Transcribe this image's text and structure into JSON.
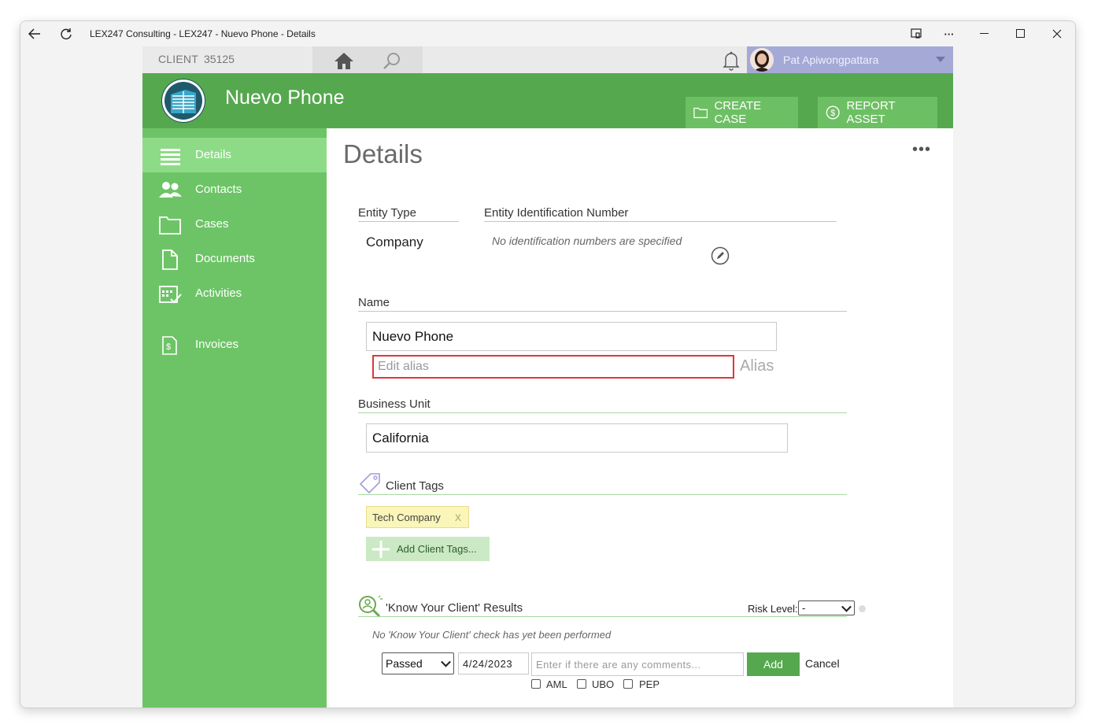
{
  "window": {
    "title": "LEX247 Consulting - LEX247 - Nuevo Phone - Details"
  },
  "topbar": {
    "client_label": "CLIENT",
    "client_id": "35125",
    "user_name": "Pat Apiwongpattara"
  },
  "banner": {
    "company_name": "Nuevo Phone",
    "create_case": "CREATE CASE",
    "report_asset": "REPORT ASSET"
  },
  "sidebar": {
    "items": [
      {
        "label": "Details",
        "icon": "list-icon",
        "active": true
      },
      {
        "label": "Contacts",
        "icon": "contacts-icon"
      },
      {
        "label": "Cases",
        "icon": "folder-icon"
      },
      {
        "label": "Documents",
        "icon": "document-icon"
      },
      {
        "label": "Activities",
        "icon": "calendar-check-icon"
      },
      {
        "label": "Invoices",
        "icon": "invoice-icon"
      }
    ]
  },
  "page": {
    "title": "Details",
    "more": "•••",
    "entity_type_label": "Entity Type",
    "entity_type_value": "Company",
    "entity_id_label": "Entity Identification Number",
    "entity_id_note": "No identification numbers are specified",
    "name_label": "Name",
    "name_value": "Nuevo Phone",
    "alias_placeholder": "Edit alias",
    "alias_label": "Alias",
    "business_unit_label": "Business Unit",
    "business_unit_value": "California",
    "client_tags_label": "Client Tags",
    "tags": [
      {
        "label": "Tech Company",
        "remove": "X"
      }
    ],
    "add_tags_label": "Add Client Tags...",
    "kyc_label": "'Know Your Client' Results",
    "risk_level_label": "Risk Level:",
    "risk_level_value": "-",
    "kyc_note": "No 'Know Your Client' check has yet been performed",
    "kyc_status": "Passed",
    "kyc_date": "4/24/2023",
    "comment_placeholder": "Enter if there are any comments...",
    "add_button": "Add",
    "cancel": "Cancel",
    "checks": [
      "AML",
      "UBO",
      "PEP"
    ]
  }
}
